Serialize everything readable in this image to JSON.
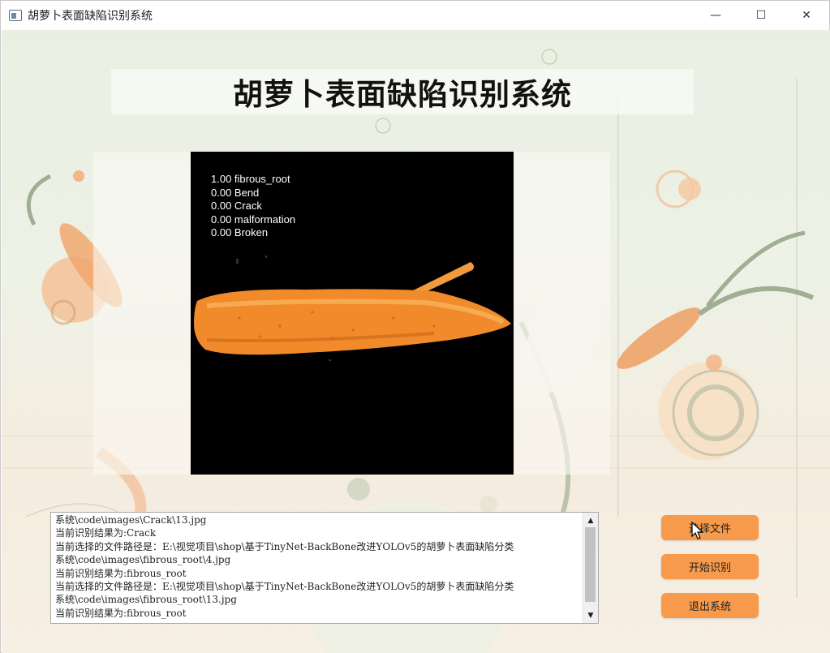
{
  "window": {
    "title": "胡萝卜表面缺陷识别系统",
    "controls": {
      "minimize": "—",
      "maximize": "☐",
      "close": "✕"
    },
    "icon": "app-window-icon"
  },
  "main": {
    "title": "胡萝卜表面缺陷识别系统"
  },
  "detection": {
    "scores": [
      "1.00 fibrous_root",
      "0.00 Bend",
      "0.00 Crack",
      "0.00 malformation",
      "0.00 Broken"
    ],
    "image": "carrot-photo"
  },
  "log": {
    "lines": [
      "系统\\code\\images\\Crack\\13.jpg",
      "当前识别结果为:Crack",
      "当前选择的文件路径是：E:\\视觉项目\\shop\\基于TinyNet-BackBone改进YOLOv5的胡萝卜表面缺陷分类",
      "系统\\code\\images\\fibrous_root\\4.jpg",
      "当前识别结果为:fibrous_root",
      "当前选择的文件路径是：E:\\视觉项目\\shop\\基于TinyNet-BackBone改进YOLOv5的胡萝卜表面缺陷分类",
      "系统\\code\\images\\fibrous_root\\13.jpg",
      "当前识别结果为:fibrous_root"
    ],
    "scroll_up": "▲",
    "scroll_down": "▼"
  },
  "buttons": {
    "select_file": "选择文件",
    "start": "开始识别",
    "exit": "退出系统"
  },
  "colors": {
    "button_bg": "#f79a4b",
    "viewer_bg": "#000000",
    "carrot": "#f08a2a"
  }
}
